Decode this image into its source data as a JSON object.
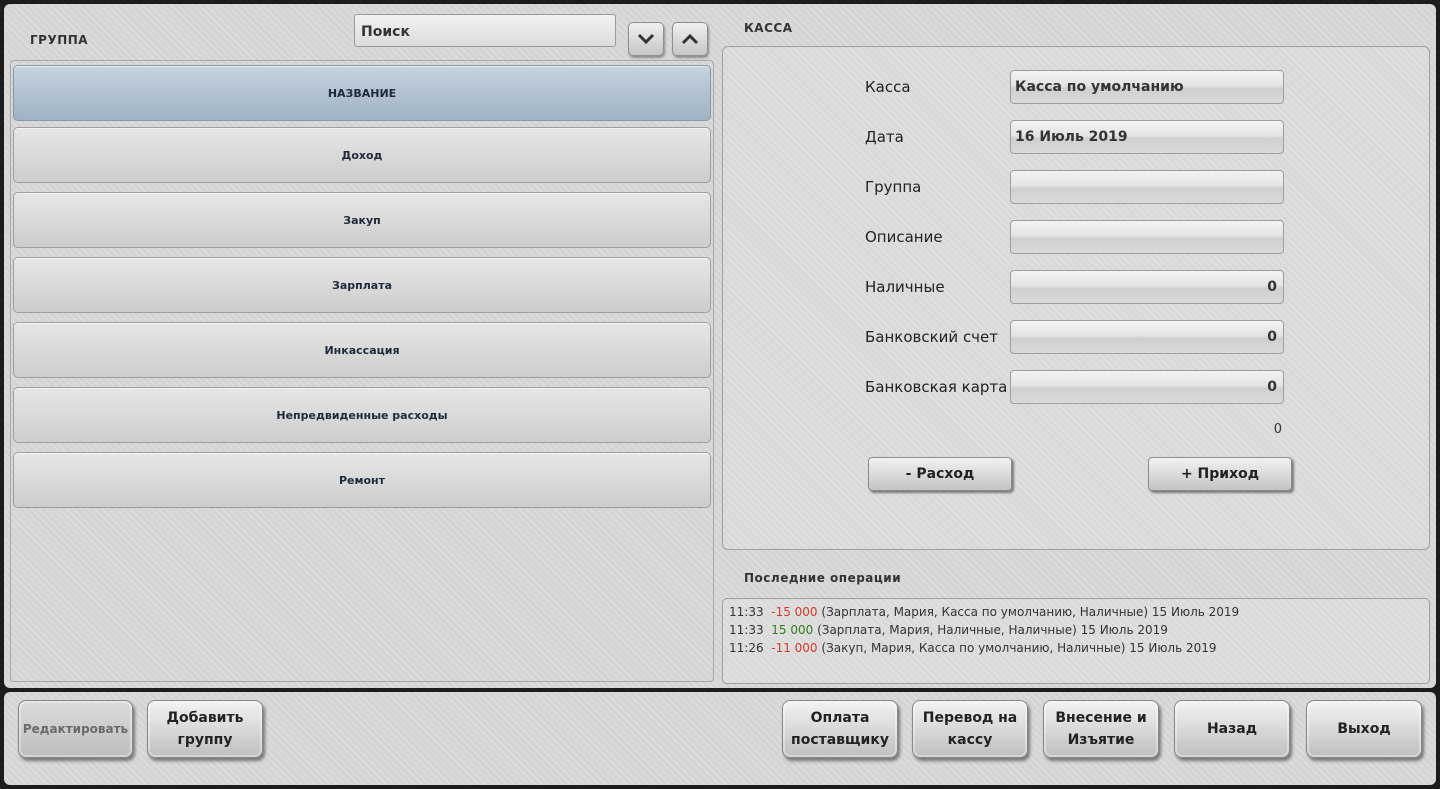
{
  "left": {
    "title": "ГРУППА",
    "search_placeholder": "Поиск",
    "header_label": "НАЗВАНИЕ",
    "groups": [
      "Доход",
      "Закуп",
      "Зарплата",
      "Инкассация",
      "Непредвиденные расходы",
      "Ремонт"
    ]
  },
  "right": {
    "title": "КАССА",
    "fields": {
      "kassa": {
        "label": "Касса",
        "value": "Касса по умолчанию"
      },
      "date": {
        "label": "Дата",
        "value": "16 Июль 2019"
      },
      "group": {
        "label": "Группа",
        "value": ""
      },
      "description": {
        "label": "Описание",
        "value": ""
      },
      "cash": {
        "label": "Наличные",
        "value": "0"
      },
      "bank_account": {
        "label": "Банковский счет",
        "value": "0"
      },
      "bank_card": {
        "label": "Банковская карта",
        "value": "0"
      }
    },
    "total": "0",
    "expense_button": "- Расход",
    "income_button": "+ Приход",
    "recent_title": "Последние операции",
    "operations": [
      {
        "time": "11:33",
        "amount": "-15 000",
        "details": "(Зарплата, Мария, Касса по умолчанию, Наличные) 15 Июль 2019"
      },
      {
        "time": "11:33",
        "amount": "15 000",
        "details": "(Зарплата, Мария, Наличные, Наличные) 15 Июль 2019"
      },
      {
        "time": "11:26",
        "amount": "-11 000",
        "details": "(Закуп, Мария, Касса по умолчанию, Наличные) 15 Июль 2019"
      }
    ]
  },
  "bottom": {
    "edit": "Редактировать",
    "add_group": "Добавить\nгруппу",
    "pay_supplier": "Оплата\nпоставщику",
    "transfer": "Перевод на\nкассу",
    "deposit_withdraw": "Внесение и\nИзъятие",
    "back": "Назад",
    "exit": "Выход"
  },
  "colors": {
    "negative": "#d23a2a",
    "positive": "#2f7d1f",
    "header_row": "#b3c3d2"
  }
}
